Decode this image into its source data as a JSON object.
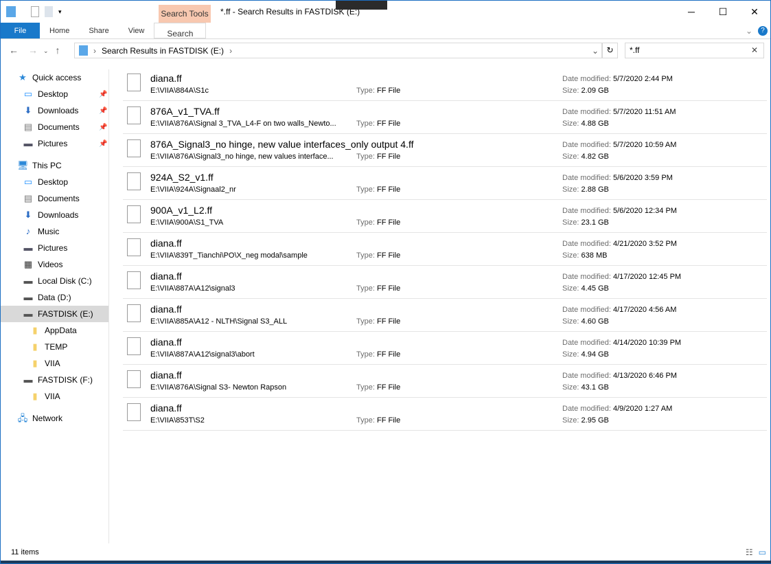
{
  "window": {
    "title": "*.ff - Search Results in FASTDISK (E:)",
    "context_tab": "Search Tools",
    "minimize": "─",
    "maximize": "☐",
    "close": "✕"
  },
  "ribbon": {
    "tabs": [
      "File",
      "Home",
      "Share",
      "View",
      "Search"
    ]
  },
  "address": {
    "path": "Search Results in FASTDISK (E:)",
    "search_value": "*.ff"
  },
  "sidebar": {
    "items": [
      {
        "label": "Quick access",
        "icon": "star-icon",
        "glyph": "★",
        "color": "#2b88d8",
        "indent": 24,
        "pin": false
      },
      {
        "label": "Desktop",
        "icon": "desktop-icon",
        "glyph": "▭",
        "color": "#1e90ff",
        "indent": 32,
        "pin": true
      },
      {
        "label": "Downloads",
        "icon": "download-icon",
        "glyph": "⬇",
        "color": "#2b6cc4",
        "indent": 32,
        "pin": true
      },
      {
        "label": "Documents",
        "icon": "documents-icon",
        "glyph": "▤",
        "color": "#777",
        "indent": 32,
        "pin": true
      },
      {
        "label": "Pictures",
        "icon": "pictures-icon",
        "glyph": "▬",
        "color": "#556",
        "indent": 32,
        "pin": true
      },
      {
        "label": "This PC",
        "icon": "computer-icon",
        "glyph": "🖥",
        "color": "#2b88d8",
        "indent": 24,
        "pin": false,
        "gap": true
      },
      {
        "label": "Desktop",
        "icon": "desktop-icon",
        "glyph": "▭",
        "color": "#1e90ff",
        "indent": 32
      },
      {
        "label": "Documents",
        "icon": "documents-icon",
        "glyph": "▤",
        "color": "#777",
        "indent": 32
      },
      {
        "label": "Downloads",
        "icon": "download-icon",
        "glyph": "⬇",
        "color": "#2b6cc4",
        "indent": 32
      },
      {
        "label": "Music",
        "icon": "music-icon",
        "glyph": "♪",
        "color": "#2b6cc4",
        "indent": 32
      },
      {
        "label": "Pictures",
        "icon": "pictures-icon",
        "glyph": "▬",
        "color": "#556",
        "indent": 32
      },
      {
        "label": "Videos",
        "icon": "video-icon",
        "glyph": "▦",
        "color": "#333",
        "indent": 32
      },
      {
        "label": "Local Disk (C:)",
        "icon": "drive-icon",
        "glyph": "▬",
        "color": "#555",
        "indent": 32
      },
      {
        "label": "Data (D:)",
        "icon": "drive-icon",
        "glyph": "▬",
        "color": "#555",
        "indent": 32
      },
      {
        "label": "FASTDISK (E:)",
        "icon": "drive-icon",
        "glyph": "▬",
        "color": "#555",
        "indent": 32,
        "selected": true
      },
      {
        "label": "AppData",
        "icon": "folder-icon",
        "glyph": "▮",
        "color": "#f5d16b",
        "indent": 42
      },
      {
        "label": "TEMP",
        "icon": "folder-icon",
        "glyph": "▮",
        "color": "#f5d16b",
        "indent": 42
      },
      {
        "label": "VIIA",
        "icon": "folder-icon",
        "glyph": "▮",
        "color": "#f5d16b",
        "indent": 42
      },
      {
        "label": "FASTDISK (F:)",
        "icon": "drive-icon",
        "glyph": "▬",
        "color": "#555",
        "indent": 32
      },
      {
        "label": "VIIA",
        "icon": "folder-icon",
        "glyph": "▮",
        "color": "#f5d16b",
        "indent": 42
      },
      {
        "label": "Network",
        "icon": "network-icon",
        "glyph": "🖧",
        "color": "#2b88d8",
        "indent": 24,
        "gap": true
      }
    ]
  },
  "labels": {
    "type": "Type:",
    "date": "Date modified:",
    "size": "Size:"
  },
  "files": [
    {
      "name": "diana.ff",
      "path": "E:\\VIIA\\884A\\S1c",
      "type": "FF File",
      "date": "5/7/2020 2:44 PM",
      "size": "2.09 GB"
    },
    {
      "name": "876A_v1_TVA.ff",
      "path": "E:\\VIIA\\876A\\Signal 3_TVA_L4-F on two walls_Newto...",
      "type": "FF File",
      "date": "5/7/2020 11:51 AM",
      "size": "4.88 GB"
    },
    {
      "name": "876A_Signal3_no hinge, new value interfaces_only output 4.ff",
      "path": "E:\\VIIA\\876A\\Signal3_no hinge, new values interface...",
      "type": "FF File",
      "date": "5/7/2020 10:59 AM",
      "size": "4.82 GB"
    },
    {
      "name": "924A_S2_v1.ff",
      "path": "E:\\VIIA\\924A\\Signaal2_nr",
      "type": "FF File",
      "date": "5/6/2020 3:59 PM",
      "size": "2.88 GB"
    },
    {
      "name": "900A_v1_L2.ff",
      "path": "E:\\VIIA\\900A\\S1_TVA",
      "type": "FF File",
      "date": "5/6/2020 12:34 PM",
      "size": "23.1 GB"
    },
    {
      "name": "diana.ff",
      "path": "E:\\VIIA\\839T_Tianchi\\PO\\X_neg modal\\sample",
      "type": "FF File",
      "date": "4/21/2020 3:52 PM",
      "size": "638 MB"
    },
    {
      "name": "diana.ff",
      "path": "E:\\VIIA\\887A\\A12\\signal3",
      "type": "FF File",
      "date": "4/17/2020 12:45 PM",
      "size": "4.45 GB"
    },
    {
      "name": "diana.ff",
      "path": "E:\\VIIA\\885A\\A12 - NLTH\\Signal S3_ALL",
      "type": "FF File",
      "date": "4/17/2020 4:56 AM",
      "size": "4.60 GB"
    },
    {
      "name": "diana.ff",
      "path": "E:\\VIIA\\887A\\A12\\signal3\\abort",
      "type": "FF File",
      "date": "4/14/2020 10:39 PM",
      "size": "4.94 GB"
    },
    {
      "name": "diana.ff",
      "path": "E:\\VIIA\\876A\\Signal S3- Newton Rapson",
      "type": "FF File",
      "date": "4/13/2020 6:46 PM",
      "size": "43.1 GB"
    },
    {
      "name": "diana.ff",
      "path": "E:\\VIIA\\853T\\S2",
      "type": "FF File",
      "date": "4/9/2020 1:27 AM",
      "size": "2.95 GB"
    }
  ],
  "status": {
    "count": "11 items"
  }
}
